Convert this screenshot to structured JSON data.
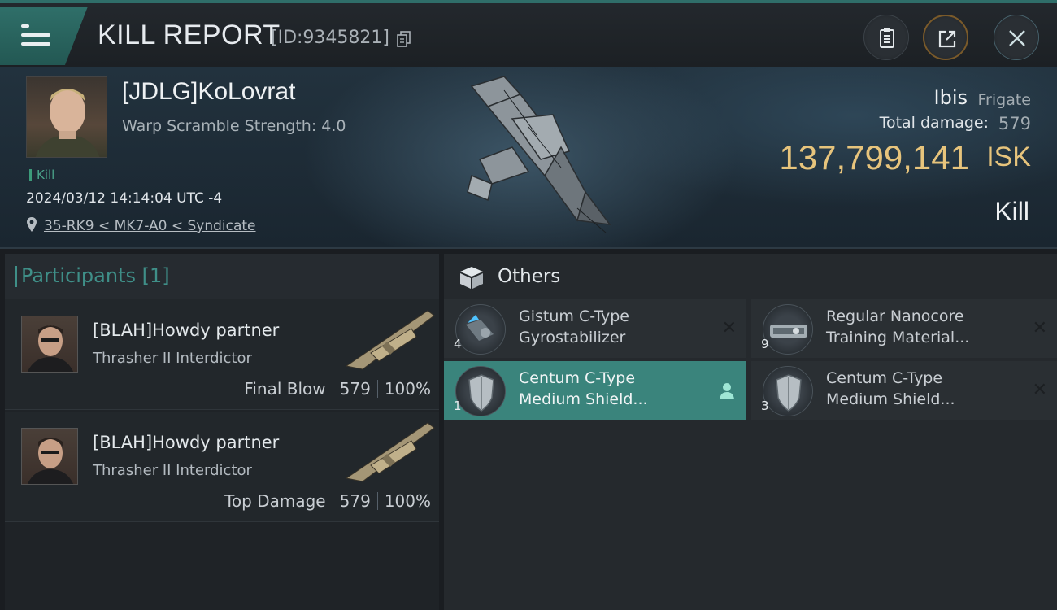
{
  "header": {
    "title": "KILL REPORT",
    "report_id": "[ID:9345821]"
  },
  "victim": {
    "name": "[JDLG]KoLovrat",
    "warp_scramble": "Warp Scramble Strength: 4.0",
    "tag": "Kill",
    "datetime": "2024/03/12 14:14:04 UTC -4",
    "location": "35-RK9 < MK7-A0 < Syndicate"
  },
  "ship": {
    "name": "Ibis",
    "class": "Frigate",
    "total_damage_label": "Total damage:",
    "total_damage": "579",
    "isk_value": "137,799,141",
    "isk_unit": "ISK",
    "result": "Kill"
  },
  "participants": {
    "heading": "Participants [1]",
    "rows": [
      {
        "name": "[BLAH]Howdy partner",
        "ship": "Thrasher II Interdictor",
        "role": "Final Blow",
        "damage": "579",
        "percent": "100%"
      },
      {
        "name": "[BLAH]Howdy partner",
        "ship": "Thrasher II Interdictor",
        "role": "Top Damage",
        "damage": "579",
        "percent": "100%"
      }
    ]
  },
  "others": {
    "heading": "Others",
    "items": [
      {
        "name": "Gistum C-Type\nGyrostabilizer",
        "qty": "4",
        "icon": "gyrostabilizer-icon"
      },
      {
        "name": "Regular Nanocore\nTraining Material...",
        "qty": "9",
        "icon": "nanocore-icon"
      },
      {
        "name": "Centum C-Type\nMedium Shield...",
        "qty": "1",
        "icon": "shield-icon"
      },
      {
        "name": "Centum C-Type\nMedium Shield...",
        "qty": "3",
        "icon": "shield-icon"
      }
    ]
  },
  "colors": {
    "accent": "#3a847c",
    "isk": "#e7c47c",
    "header_text_teal": "#3f8f88"
  }
}
